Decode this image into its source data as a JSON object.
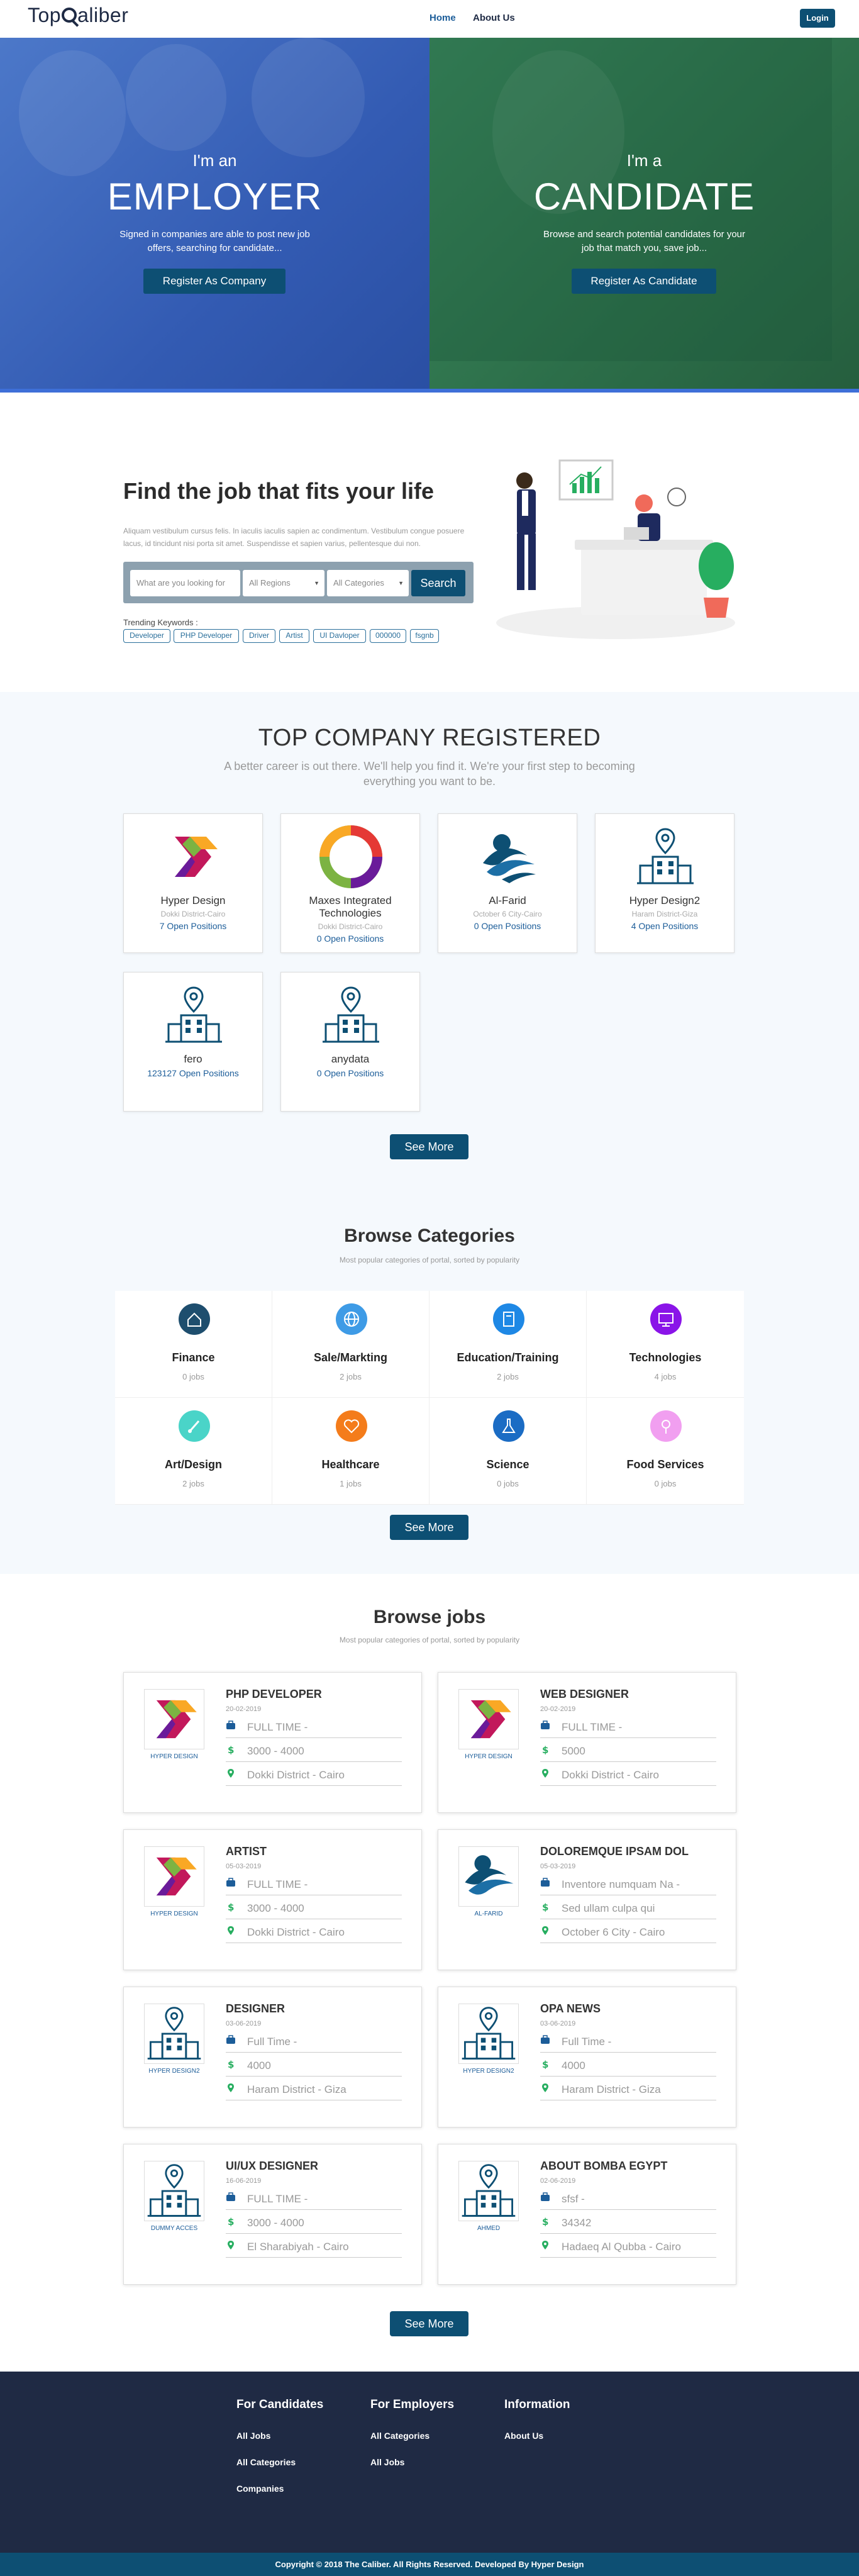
{
  "header": {
    "logo_text_left": "Top",
    "logo_text_right": "aliber",
    "nav": [
      {
        "label": "Home"
      },
      {
        "label": "About Us"
      }
    ],
    "login_label": "Login"
  },
  "hero": {
    "employer": {
      "intro": "I'm an",
      "title": "EMPLOYER",
      "desc": "Signed in companies are able to post new job offers, searching for candidate...",
      "button": "Register As Company"
    },
    "candidate": {
      "intro": "I'm a",
      "title": "CANDIDATE",
      "desc": "Browse and search potential candidates for your job that match you, save job...",
      "button": "Register As Candidate"
    }
  },
  "find": {
    "title": "Find the job that fits your life",
    "desc": "Aliquam vestibulum cursus felis. In iaculis iaculis sapien ac condimentum. Vestibulum congue posuere lacus, id tincidunt nisi porta sit amet. Suspendisse et sapien varius, pellentesque dui non.",
    "search_placeholder": "What are you looking for",
    "region": "All Regions",
    "category": "All Categories",
    "search_button": "Search",
    "trending_label": "Trending Keywords :",
    "keywords": [
      "Developer",
      "PHP Developer",
      "Driver",
      "Artist",
      "UI Davloper",
      "000000",
      "fsgnb"
    ]
  },
  "companies": {
    "title": "TOP COMPANY REGISTERED",
    "subtitle": "A better career is out there. We'll help you find it. We're your first step to becoming everything you want to be.",
    "items": [
      {
        "name": "Hyper Design",
        "location": "Dokki District-Cairo",
        "open": "7 Open Positions"
      },
      {
        "name": "Maxes Integrated Technologies",
        "location": "Dokki District-Cairo",
        "open": "0 Open Positions"
      },
      {
        "name": "Al-Farid",
        "location": "October 6 City-Cairo",
        "open": "0 Open Positions"
      },
      {
        "name": "Hyper Design2",
        "location": "Haram District-Giza",
        "open": "4 Open Positions"
      },
      {
        "name": "fero",
        "location": "",
        "open": "123127 Open Positions"
      },
      {
        "name": "anydata",
        "location": "",
        "open": "0 Open Positions"
      }
    ],
    "see_more": "See More"
  },
  "categories": {
    "title": "Browse Categories",
    "subtitle": "Most popular categories of portal, sorted by popularity",
    "items": [
      {
        "label": "Finance",
        "jobs": "0 jobs",
        "icon": "home-icon",
        "color": "#1e4e6e"
      },
      {
        "label": "Sale/Markting",
        "jobs": "2 jobs",
        "icon": "globe-icon",
        "color": "#3e9be6"
      },
      {
        "label": "Education/Training",
        "jobs": "2 jobs",
        "icon": "book-icon",
        "color": "#1e88e5"
      },
      {
        "label": "Technologies",
        "jobs": "4 jobs",
        "icon": "monitor-icon",
        "color": "#8a14e8"
      },
      {
        "label": "Art/Design",
        "jobs": "2 jobs",
        "icon": "brush-icon",
        "color": "#4ad4c8"
      },
      {
        "label": "Healthcare",
        "jobs": "1 jobs",
        "icon": "heart-icon",
        "color": "#f47c1b"
      },
      {
        "label": "Science",
        "jobs": "0 jobs",
        "icon": "flask-icon",
        "color": "#1b6cc4"
      },
      {
        "label": "Food Services",
        "jobs": "0 jobs",
        "icon": "food-icon",
        "color": "#f19ff0"
      }
    ],
    "see_more": "See More"
  },
  "jobs": {
    "title": "Browse jobs",
    "subtitle": "Most popular categories of portal, sorted by popularity",
    "items": [
      {
        "title": "PHP DEVELOPER",
        "date": "20-02-2019",
        "company": "HYPER DESIGN",
        "logo": "hyper-design-logo",
        "type": "FULL TIME -",
        "salary": "3000 - 4000",
        "location": "Dokki District - Cairo"
      },
      {
        "title": "WEB DESIGNER",
        "date": "20-02-2019",
        "company": "HYPER DESIGN",
        "logo": "hyper-design-logo",
        "type": "FULL TIME -",
        "salary": "5000",
        "location": "Dokki District - Cairo"
      },
      {
        "title": "ARTIST",
        "date": "05-03-2019",
        "company": "HYPER DESIGN",
        "logo": "hyper-design-logo",
        "type": "FULL TIME -",
        "salary": "3000 - 4000",
        "location": "Dokki District - Cairo"
      },
      {
        "title": "DOLOREMQUE IPSAM DOL",
        "date": "05-03-2019",
        "company": "AL-FARID",
        "logo": "al-farid-logo",
        "type": "Inventore numquam Na -",
        "salary": "Sed ullam culpa qui",
        "location": "October 6 City - Cairo"
      },
      {
        "title": "DESIGNER",
        "date": "03-06-2019",
        "company": "HYPER DESIGN2",
        "logo": "building-logo",
        "type": "Full Time -",
        "salary": "4000",
        "location": "Haram District - Giza"
      },
      {
        "title": "OPA NEWS",
        "date": "03-06-2019",
        "company": "HYPER DESIGN2",
        "logo": "building-logo",
        "type": "Full Time -",
        "salary": "4000",
        "location": "Haram District - Giza"
      },
      {
        "title": "UI/UX DESIGNER",
        "date": "16-06-2019",
        "company": "DUMMY ACCES",
        "logo": "building-logo",
        "type": "FULL TIME -",
        "salary": "3000 - 4000",
        "location": "El Sharabiyah - Cairo"
      },
      {
        "title": "ABOUT BOMBA EGYPT",
        "date": "02-06-2019",
        "company": "AHMED",
        "logo": "building-logo",
        "type": "sfsf -",
        "salary": "34342",
        "location": "Hadaeq Al Qubba - Cairo"
      }
    ],
    "see_more": "See More"
  },
  "footer": {
    "cols": [
      {
        "title": "For Candidates",
        "links": [
          "All Jobs",
          "All Categories",
          "Companies"
        ]
      },
      {
        "title": "For Employers",
        "links": [
          "All Categories",
          "All Jobs"
        ]
      },
      {
        "title": "Information",
        "links": [
          "About Us"
        ]
      }
    ],
    "copyright": "Copyright © 2018 The Caliber. All Rights Reserved. Developed By Hyper Design"
  },
  "colors": {
    "primary": "#0d4f73",
    "employer": "#335bb3",
    "candidate": "#2c6e49",
    "footer": "#1f2a44"
  }
}
